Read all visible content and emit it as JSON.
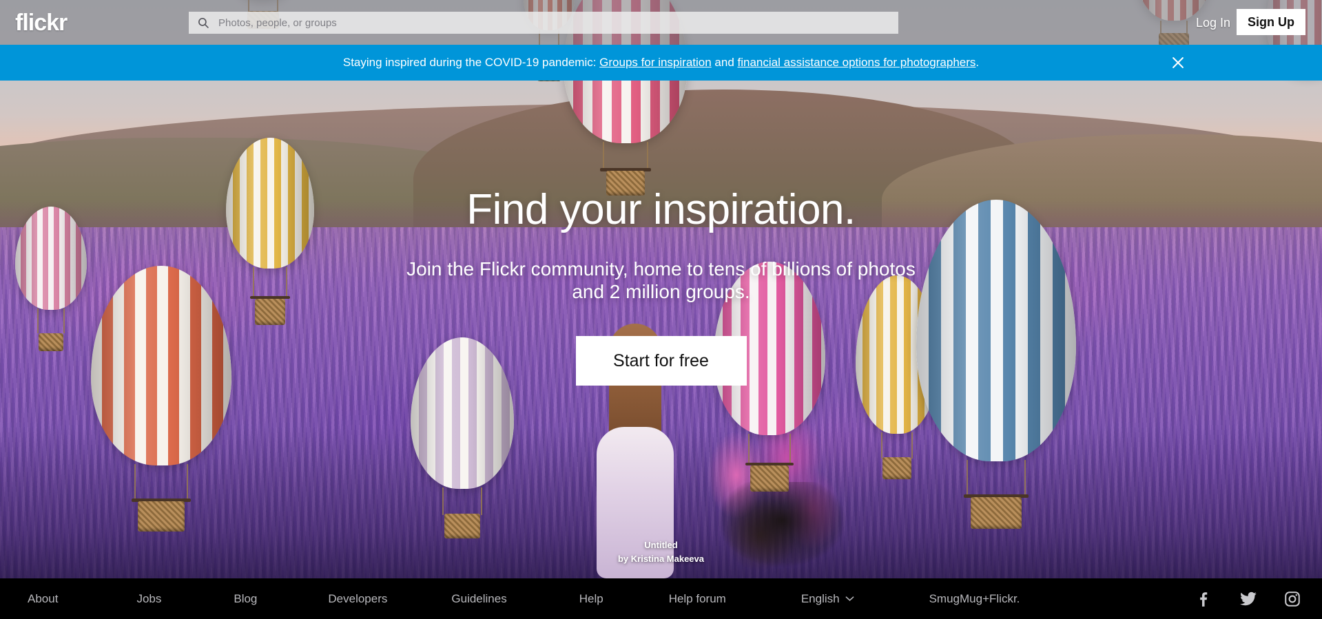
{
  "header": {
    "logo": "flickr",
    "search": {
      "placeholder": "Photos, people, or groups",
      "value": "",
      "icon": "search-icon"
    },
    "login_label": "Log In",
    "signup_label": "Sign Up"
  },
  "banner": {
    "lead": "Staying inspired during the COVID-19 pandemic: ",
    "link1": "Groups for inspiration",
    "middle": " and ",
    "link2": "financial assistance options for photographers",
    "tail": ".",
    "close_icon": "close-icon",
    "background_color": "#0095d9"
  },
  "hero": {
    "title": "Find your inspiration.",
    "subtitle": "Join the Flickr community, home to tens of billions of photos and 2 million groups.",
    "cta_label": "Start for free",
    "photo_title": "Untitled",
    "photo_credit": "by Kristina Makeeva"
  },
  "footer": {
    "links": [
      {
        "label": "About"
      },
      {
        "label": "Jobs"
      },
      {
        "label": "Blog"
      },
      {
        "label": "Developers"
      },
      {
        "label": "Guidelines"
      },
      {
        "label": "Help"
      },
      {
        "label": "Help forum"
      }
    ],
    "language": "English",
    "language_chevron": "chevron-down-icon",
    "brand": "SmugMug+Flickr.",
    "socials": [
      {
        "name": "facebook-icon"
      },
      {
        "name": "twitter-icon"
      },
      {
        "name": "instagram-icon"
      }
    ],
    "background_color": "#000000",
    "text_color": "#b9b9bd"
  }
}
